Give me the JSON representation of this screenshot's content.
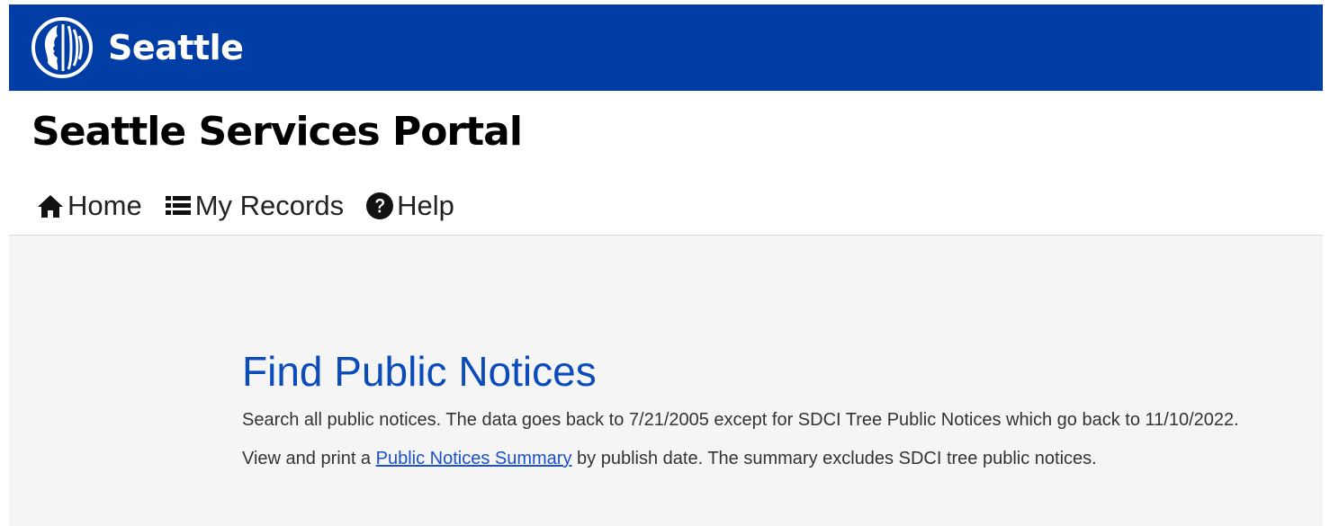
{
  "topbar": {
    "logo_icon": "seattle-seal-icon",
    "brand_name": "Seattle",
    "color": "#003da5"
  },
  "portal": {
    "title": "Seattle Services Portal"
  },
  "nav": {
    "items": [
      {
        "label": "Home",
        "icon": "home-icon"
      },
      {
        "label": "My Records",
        "icon": "list-icon"
      },
      {
        "label": "Help",
        "icon": "question-circle-icon"
      }
    ]
  },
  "main": {
    "title": "Find Public Notices",
    "title_color": "#0b4cba",
    "description": "Search all public notices. The data goes back to 7/21/2005 except for SDCI Tree Public Notices which go back to 11/10/2022.",
    "summary_prefix": "View and print a ",
    "summary_link": "Public Notices Summary",
    "summary_suffix": " by publish date. The summary excludes SDCI tree public notices."
  }
}
